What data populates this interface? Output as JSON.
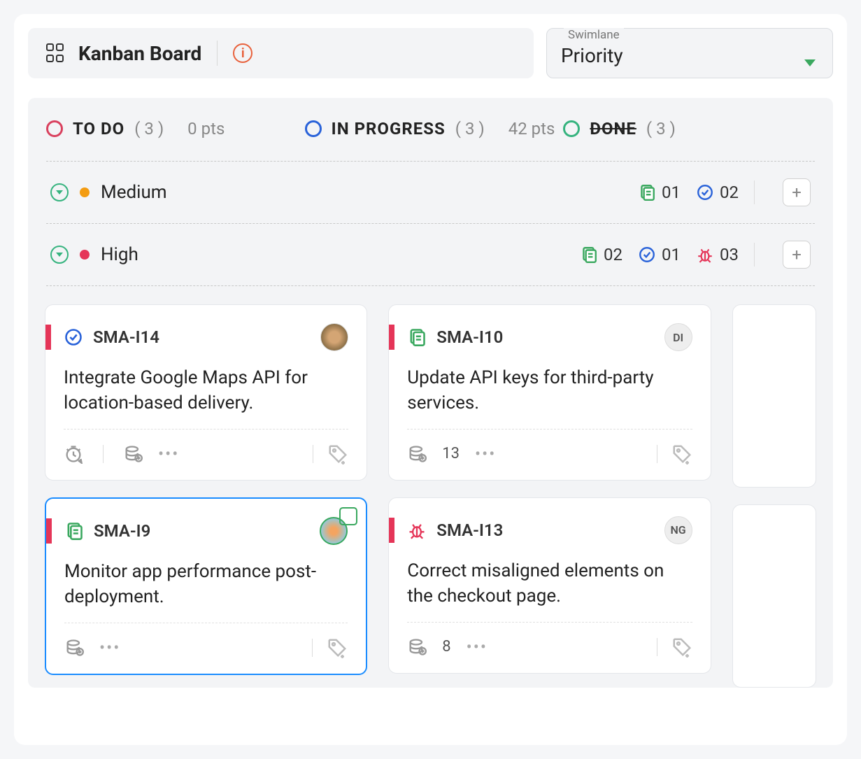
{
  "header": {
    "title": "Kanban Board",
    "swimlane_label": "Swimlane",
    "swimlane_value": "Priority"
  },
  "columns": [
    {
      "name": "TO DO",
      "count": "( 3 )",
      "pts": "0 pts",
      "ring": "ring-red",
      "done": false
    },
    {
      "name": "IN PROGRESS",
      "count": "( 3 )",
      "pts": "42 pts",
      "ring": "ring-blue",
      "done": false
    },
    {
      "name": "DONE",
      "count": "( 3 )",
      "pts": "",
      "ring": "ring-green",
      "done": true
    }
  ],
  "lanes": [
    {
      "name": "Medium",
      "dot": "dot-orange",
      "stats": [
        {
          "type": "story",
          "val": "01"
        },
        {
          "type": "task",
          "val": "02"
        }
      ]
    },
    {
      "name": "High",
      "dot": "dot-red",
      "stats": [
        {
          "type": "story",
          "val": "02"
        },
        {
          "type": "task",
          "val": "01"
        },
        {
          "type": "bug",
          "val": "03"
        }
      ]
    }
  ],
  "cards": {
    "col1": [
      {
        "id": "SMA-I14",
        "icon": "task",
        "title": "Integrate Google Maps API for location-based delivery.",
        "avatar": "img1",
        "avatar_text": "",
        "timer": true,
        "db": true,
        "selected": false
      },
      {
        "id": "SMA-I9",
        "icon": "story",
        "title": "Monitor app performance post-deployment.",
        "avatar": "img2",
        "avatar_text": "",
        "timer": false,
        "db": true,
        "selected": true
      }
    ],
    "col2": [
      {
        "id": "SMA-I10",
        "icon": "story",
        "title": "Update API keys for third-party services.",
        "avatar": "",
        "avatar_text": "DI",
        "db_val": "13",
        "selected": false
      },
      {
        "id": "SMA-I13",
        "icon": "bug",
        "title": "Correct misaligned elements on the checkout page.",
        "avatar": "",
        "avatar_text": "NG",
        "db_val": "8",
        "selected": false
      }
    ]
  }
}
